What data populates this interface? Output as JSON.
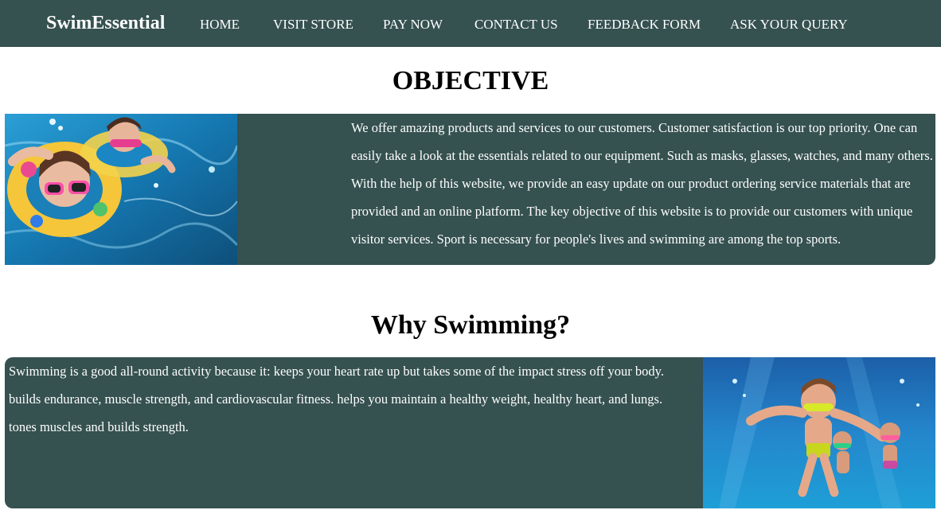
{
  "nav": {
    "brand": "SwimEssential",
    "links": [
      "HOME",
      "VISIT STORE",
      "PAY NOW",
      "CONTACT US",
      "FEEDBACK FORM",
      "ASK YOUR QUERY"
    ]
  },
  "objective": {
    "title": "OBJECTIVE",
    "text": "We offer amazing products and services to our customers. Customer satisfaction is our top priority. One can easily take a look at the essentials related to our equipment. Such as masks, glasses, watches, and many others. With the help of this website, we provide an easy update on our product ordering service materials that are provided and an online platform. The key objective of this website is to provide our customers with unique visitor services. Sport is necessary for people's lives and swimming are among the top sports."
  },
  "why": {
    "title": "Why Swimming?",
    "text": "Swimming is a good all-round activity because it: keeps your heart rate up but takes some of the impact stress off your body. builds endurance, muscle strength, and cardiovascular fitness. helps you maintain a healthy weight, healthy heart, and lungs. tones muscles and builds strength."
  },
  "colors": {
    "nav_bg": "#355150",
    "panel_bg": "#355150",
    "text_light": "#ffffff",
    "water": "#1a86c4"
  },
  "icons": {
    "objective_photo": "kids-swimming-goggles-photo",
    "why_photo": "kids-underwater-photo"
  }
}
